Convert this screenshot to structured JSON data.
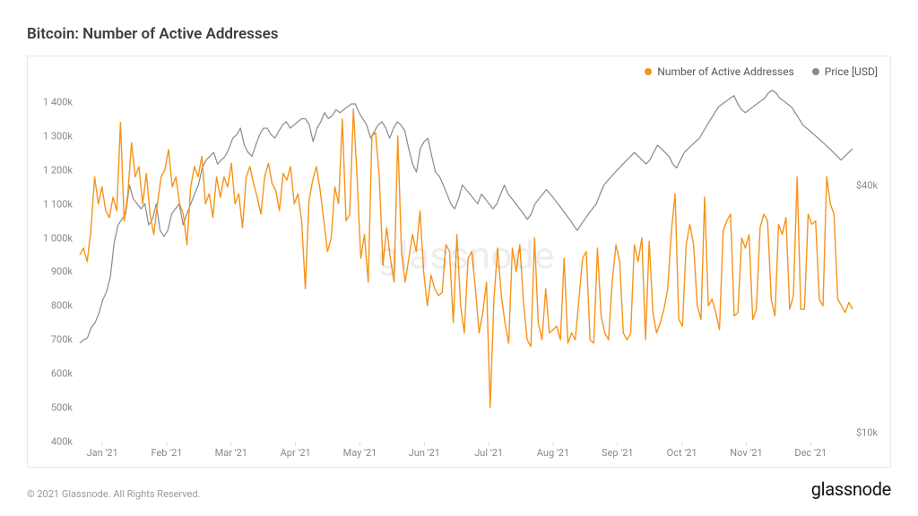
{
  "title": "Bitcoin: Number of Active Addresses",
  "legend": {
    "series1": {
      "label": "Number of Active Addresses",
      "color": "#f7931a"
    },
    "series2": {
      "label": "Price [USD]",
      "color": "#8a8a8a"
    }
  },
  "watermark": "glassnode",
  "footer": {
    "copyright": "© 2021 Glassnode. All Rights Reserved.",
    "brand": "glassnode"
  },
  "chart_data": {
    "type": "line",
    "xlabel": "",
    "x_categories": [
      "Jan '21",
      "Feb '21",
      "Mar '21",
      "Apr '21",
      "May '21",
      "Jun '21",
      "Jul '21",
      "Aug '21",
      "Sep '21",
      "Oct '21",
      "Nov '21",
      "Dec '21"
    ],
    "left_axis": {
      "label": "Number of Active Addresses",
      "ticks": [
        400000,
        500000,
        600000,
        700000,
        800000,
        900000,
        1000000,
        1100000,
        1200000,
        1300000,
        1400000
      ],
      "tick_labels": [
        "400k",
        "500k",
        "600k",
        "700k",
        "800k",
        "900k",
        "1 000k",
        "1 100k",
        "1 200k",
        "1 300k",
        "1 400k"
      ],
      "range": [
        400000,
        1450000
      ]
    },
    "right_axis": {
      "label": "Price [USD]",
      "ticks": [
        10000,
        40000
      ],
      "tick_labels": [
        "$10k",
        "$40k"
      ],
      "scale": "log",
      "range": [
        9500,
        70000
      ]
    },
    "series": [
      {
        "name": "Number of Active Addresses",
        "axis": "left",
        "color": "#f7931a",
        "values": [
          950,
          970,
          930,
          1020,
          1180,
          1100,
          1150,
          1080,
          1060,
          1120,
          1080,
          1340,
          1050,
          1130,
          1280,
          1180,
          1210,
          1100,
          1190,
          1070,
          1010,
          1100,
          1180,
          1200,
          1260,
          1150,
          1180,
          1100,
          1070,
          980,
          1150,
          1210,
          1180,
          1240,
          1100,
          1130,
          1060,
          1180,
          1120,
          1180,
          1150,
          1220,
          1100,
          1130,
          1030,
          1180,
          1210,
          1160,
          1120,
          1070,
          1180,
          1220,
          1160,
          1140,
          1080,
          1190,
          1170,
          1210,
          1100,
          1130,
          1050,
          850,
          1110,
          1170,
          1210,
          1140,
          1050,
          960,
          1000,
          1150,
          1100,
          1350,
          1050,
          1070,
          1380,
          1180,
          940,
          1010,
          870,
          1300,
          1310,
          1180,
          920,
          1030,
          940,
          870,
          1300,
          960,
          870,
          940,
          1010,
          960,
          1080,
          900,
          800,
          890,
          850,
          830,
          840,
          980,
          960,
          750,
          1010,
          800,
          720,
          940,
          960,
          850,
          720,
          780,
          870,
          500,
          820,
          970,
          830,
          750,
          690,
          970,
          900,
          980,
          810,
          700,
          680,
          1000,
          750,
          700,
          850,
          720,
          730,
          740,
          700,
          940,
          690,
          720,
          700,
          820,
          940,
          960,
          700,
          690,
          970,
          770,
          720,
          700,
          870,
          980,
          930,
          720,
          700,
          720,
          980,
          930,
          1000,
          700,
          990,
          780,
          720,
          750,
          790,
          850,
          1020,
          1130,
          760,
          740,
          980,
          1040,
          980,
          800,
          760,
          1120,
          800,
          820,
          780,
          730,
          1020,
          1050,
          1070,
          770,
          780,
          1000,
          970,
          1010,
          760,
          790,
          1030,
          1070,
          1050,
          820,
          770,
          1040,
          1010,
          1060,
          790,
          830,
          1180,
          790,
          790,
          1070,
          1040,
          1050,
          820,
          800,
          1180,
          1100,
          1070,
          820,
          800,
          780,
          810,
          790
        ],
        "values_unit": "thousands_of_addresses"
      },
      {
        "name": "Price [USD]",
        "axis": "right",
        "color": "#8a8a8a",
        "values": [
          16.5,
          16.8,
          17,
          18,
          18.5,
          19.5,
          21,
          22,
          24,
          29,
          32,
          33,
          34,
          40,
          37,
          36,
          35,
          36,
          32,
          33,
          36,
          31,
          30,
          31,
          34,
          35,
          36,
          32,
          34,
          36,
          38,
          40,
          44,
          46,
          47,
          48,
          45,
          46,
          47,
          49,
          52,
          53,
          55,
          50,
          48,
          47,
          50,
          53,
          55,
          55,
          53,
          52,
          54,
          56,
          57,
          55,
          56,
          57,
          58,
          58,
          56,
          51,
          55,
          57,
          60,
          58,
          59,
          61,
          60,
          61,
          62,
          63,
          63,
          60,
          58,
          56,
          52,
          54,
          56,
          57,
          55,
          52,
          55,
          57,
          56,
          54,
          49,
          45,
          43,
          49,
          51,
          52,
          47,
          43,
          42,
          40,
          38,
          36,
          35,
          37,
          40,
          39,
          38,
          37,
          36,
          38,
          37,
          36,
          35,
          36,
          38,
          40,
          38,
          37,
          36,
          35,
          34,
          33,
          34,
          36,
          37,
          38,
          39,
          38,
          37,
          36,
          35,
          34,
          33,
          32,
          31,
          32,
          33,
          34,
          35,
          36,
          38,
          40,
          41,
          42,
          43,
          44,
          45,
          46,
          47,
          48,
          47,
          46,
          45,
          46,
          48,
          50,
          49,
          48,
          47,
          45,
          44,
          46,
          48,
          49,
          50,
          51,
          52,
          54,
          56,
          58,
          60,
          62,
          63,
          64,
          65,
          66,
          63,
          61,
          60,
          61,
          62,
          63,
          64,
          65,
          67,
          68,
          67,
          65,
          64,
          63,
          62,
          60,
          58,
          56,
          55,
          54,
          53,
          52,
          51,
          50,
          49,
          48,
          47,
          46,
          47,
          48,
          49
        ],
        "values_unit": "thousands_usd"
      }
    ]
  }
}
